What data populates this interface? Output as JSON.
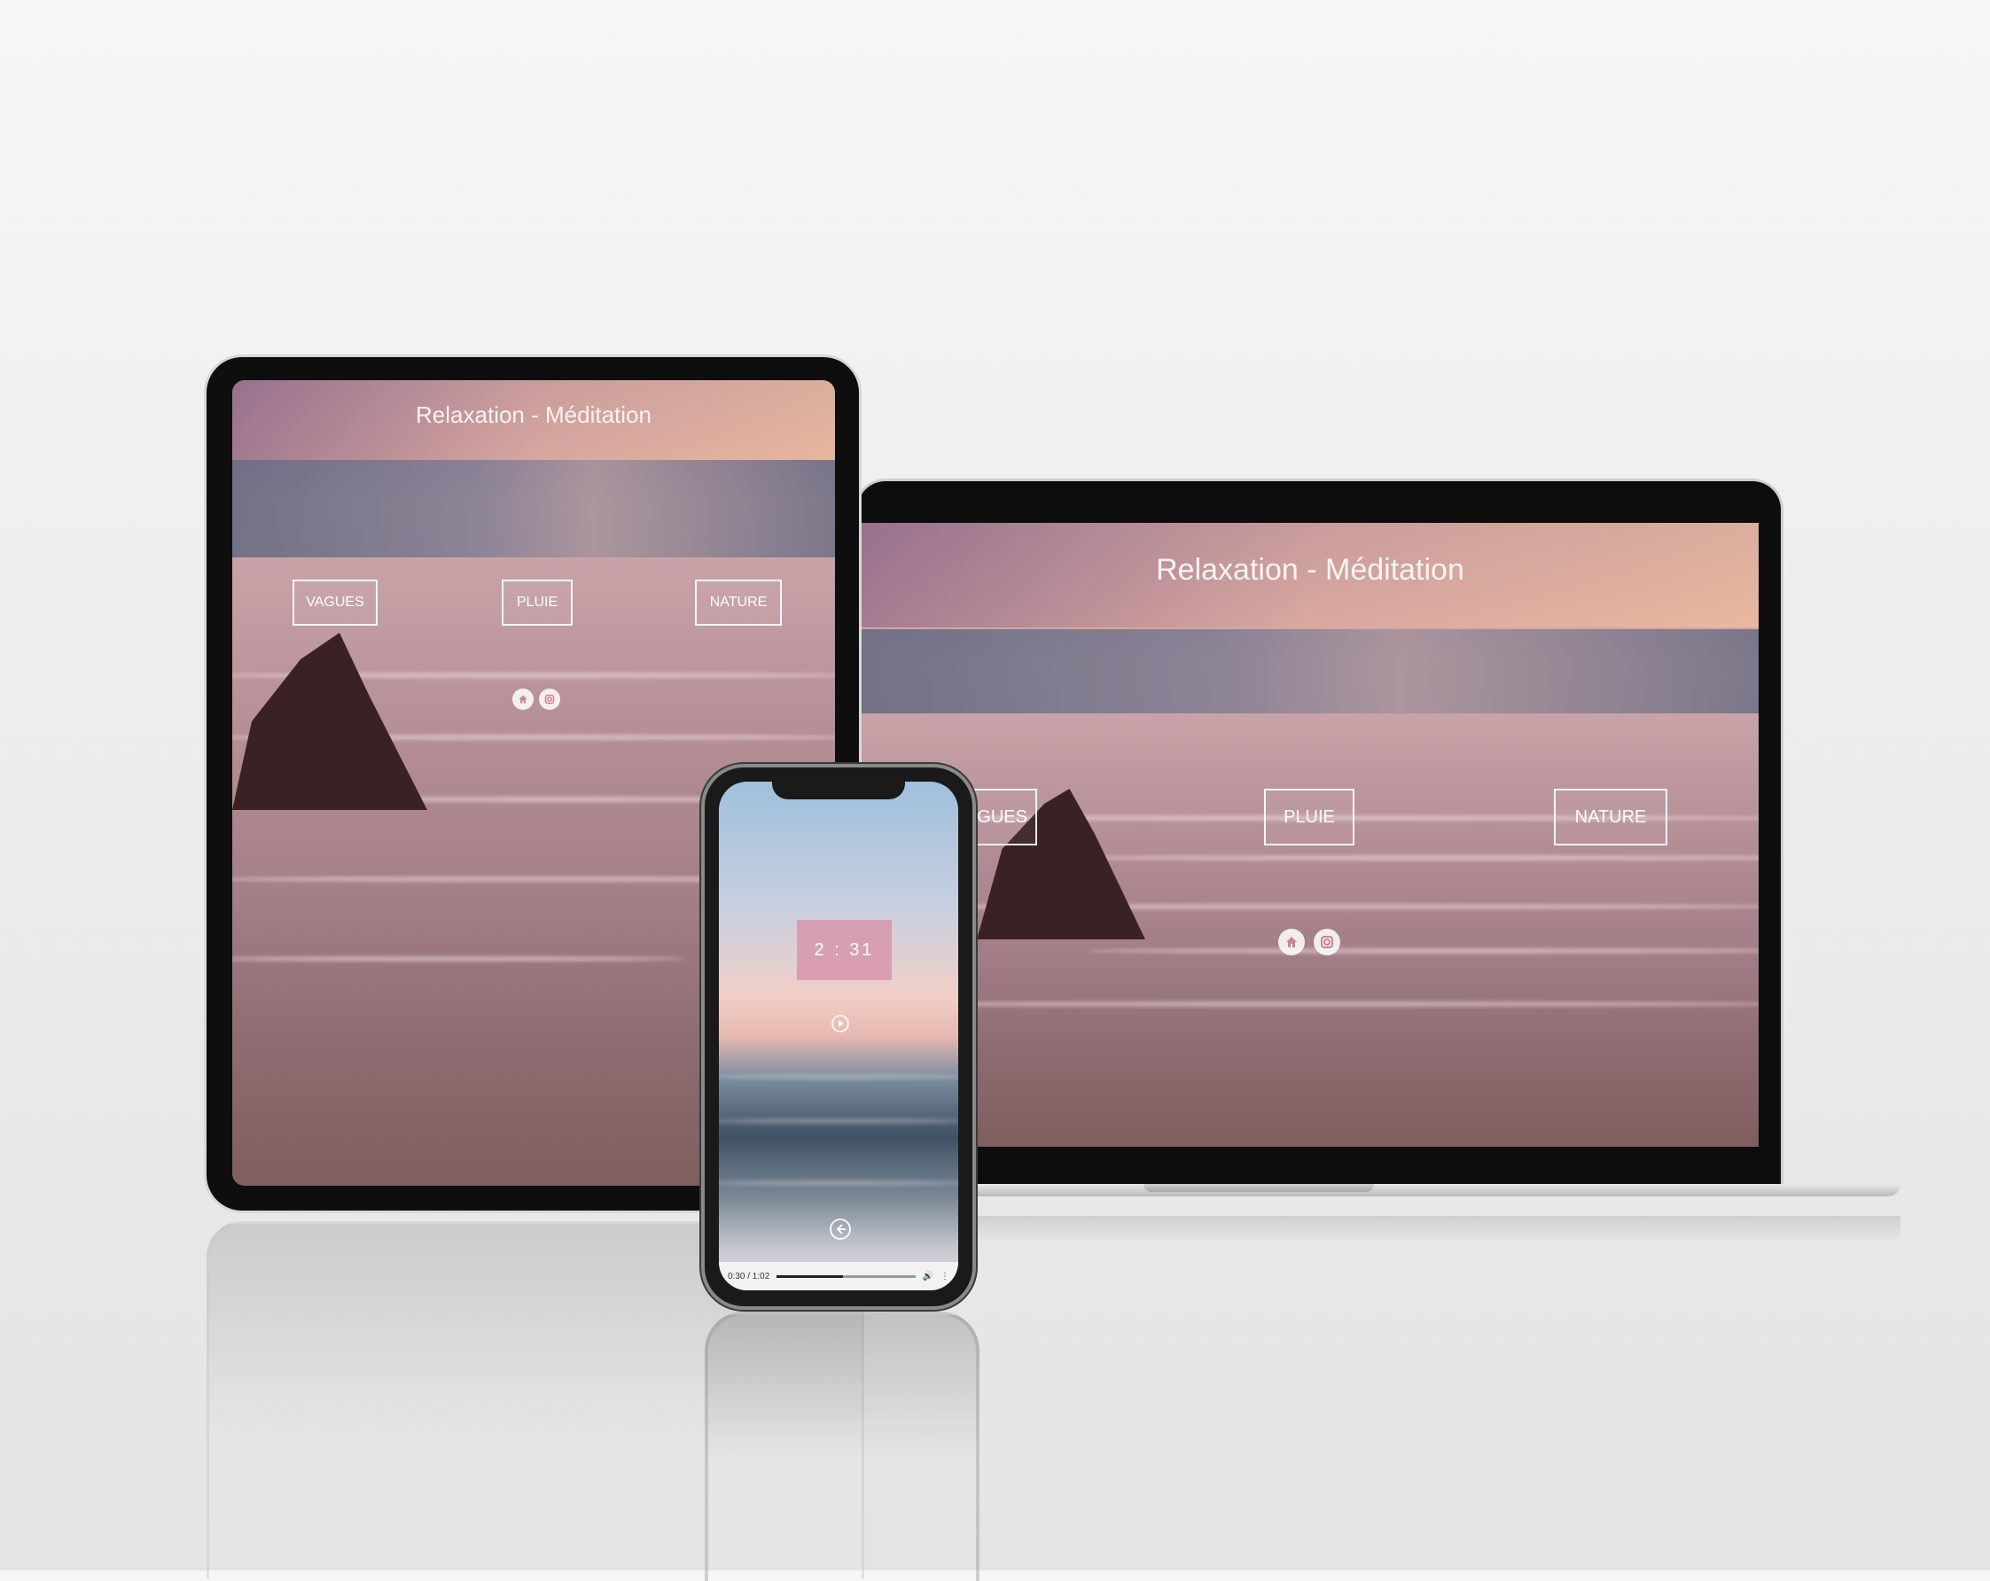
{
  "app": {
    "title": "Relaxation - Méditation"
  },
  "categories": [
    "VAGUES",
    "PLUIE",
    "NATURE"
  ],
  "icons": {
    "home": "home-icon",
    "instagram": "instagram-icon",
    "play": "play-icon",
    "back": "arrow-left-icon"
  },
  "phone": {
    "timer": "2 : 31",
    "media": {
      "time": "0:30 / 1:02",
      "progress": 0.48
    }
  },
  "colors": {
    "accent": "#d696aa",
    "text": "#ffffff"
  }
}
